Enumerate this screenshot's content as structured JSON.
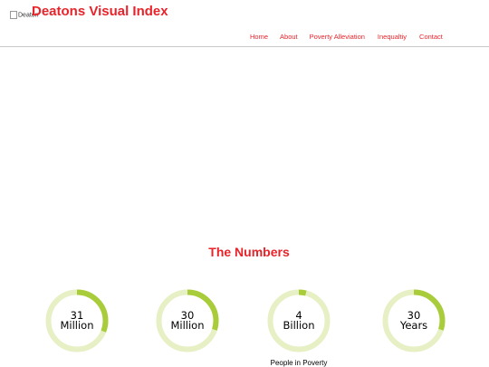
{
  "header": {
    "logo_alt": "Deaton",
    "title": "Deatons Visual Index",
    "nav": [
      {
        "label": "Home"
      },
      {
        "label": "About"
      },
      {
        "label": "Poverty Alleviation"
      },
      {
        "label": "Inequaltiy"
      },
      {
        "label": "Contact"
      }
    ]
  },
  "numbers": {
    "title": "The Numbers",
    "stats": [
      {
        "value": "31",
        "unit": "Million",
        "progress": 0.31,
        "caption": ""
      },
      {
        "value": "30",
        "unit": "Million",
        "progress": 0.3,
        "caption": ""
      },
      {
        "value": "4",
        "unit": "Billion",
        "progress": 0.04,
        "caption": "People in Poverty"
      },
      {
        "value": "30",
        "unit": "Years",
        "progress": 0.3,
        "caption": ""
      }
    ]
  },
  "colors": {
    "accent": "#e8232a",
    "ring_track": "#e6f0c4",
    "ring_fill": "#a8cc3a"
  }
}
